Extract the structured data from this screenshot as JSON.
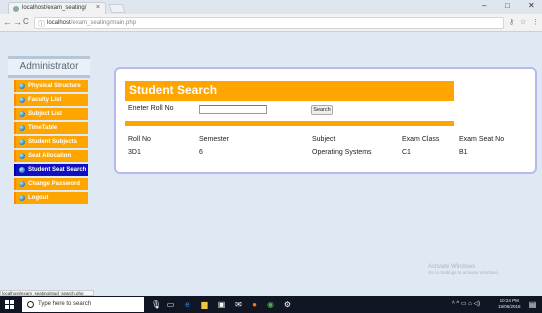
{
  "browser": {
    "tab_title": "localhost/exam_seating/",
    "tab_close": "×",
    "url_host": "localhost",
    "url_path": "/exam_seating/main.php",
    "back": "←",
    "forward": "→",
    "reload": "C",
    "info": "ⓘ",
    "key_icon": "⚷",
    "star": "☆",
    "menu": "⋮",
    "minimize": "–",
    "maximize": "□",
    "close": "✕",
    "status_url": "localhost/exam_seating/stud_search.php"
  },
  "sidebar": {
    "heading": "Administrator",
    "items": [
      {
        "label": "Physical Structure"
      },
      {
        "label": "Faculty List"
      },
      {
        "label": "Subject List"
      },
      {
        "label": "TimeTable"
      },
      {
        "label": "Student Subjects"
      },
      {
        "label": "Seat Allocation"
      },
      {
        "label": "Student Seat Search"
      },
      {
        "label": "Change Password"
      },
      {
        "label": "Logout"
      }
    ],
    "active_index": 6
  },
  "search": {
    "title": "Student Search",
    "roll_label": "Eneter Roll No",
    "roll_value": "",
    "button_label": "Search"
  },
  "results": {
    "columns": [
      "Roll No",
      "Semester",
      "Subject",
      "Exam Class",
      "Exam Seat No"
    ],
    "rows": [
      [
        "3D1",
        "6",
        "Operating Systems",
        "C1",
        "B1"
      ]
    ]
  },
  "watermark": {
    "line1": "Activate Windows",
    "line2": "Go to Settings to activate Windows."
  },
  "taskbar": {
    "search_placeholder": "Type here to search",
    "time": "10:24 PM",
    "date": "15/06/2018",
    "tray_icons": "ᴬ ^ ▭ ⌂ ◁)"
  },
  "colors": {
    "accent_orange": "#ffa500",
    "active_menu": "#1010c0",
    "page_bg": "#dfe9f4"
  }
}
